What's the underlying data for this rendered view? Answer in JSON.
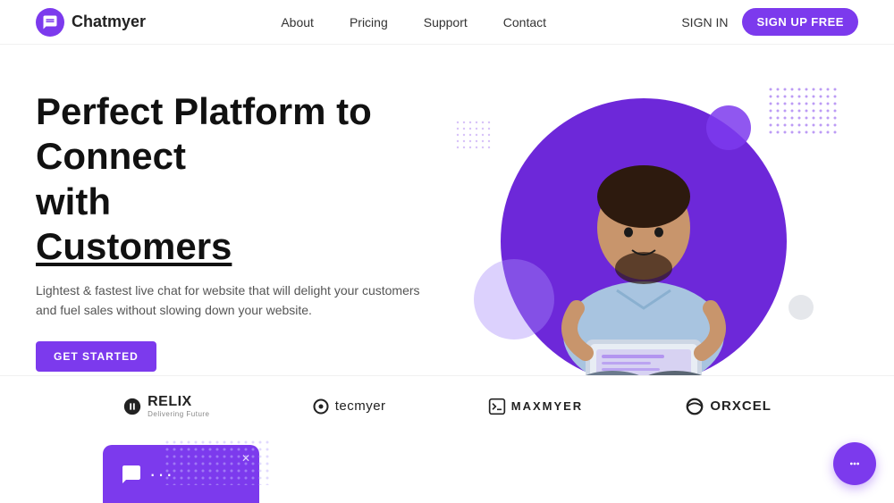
{
  "brand": {
    "icon": "💬",
    "name": "Chatmyer"
  },
  "navbar": {
    "links": [
      {
        "label": "About",
        "id": "about"
      },
      {
        "label": "Pricing",
        "id": "pricing"
      },
      {
        "label": "Support",
        "id": "support"
      },
      {
        "label": "Contact",
        "id": "contact"
      }
    ],
    "sign_in_label": "SIGN IN",
    "sign_up_label": "SIGN UP FREE"
  },
  "hero": {
    "title_line1": "Perfect Platform to Connect",
    "title_line2": "with",
    "title_underline": "Customers",
    "subtitle": "Lightest & fastest live chat for website that will delight your customers and fuel sales without slowing down your website.",
    "cta_label": "GET STARTED"
  },
  "logos": [
    {
      "id": "relix",
      "icon": "⚙",
      "name": "RELIX",
      "sub": "Delivering Future"
    },
    {
      "id": "tecmyer",
      "icon": "◎",
      "name": "tecmyer",
      "sub": ""
    },
    {
      "id": "maxmyer",
      "icon": "✕",
      "name": "MAXMYER",
      "sub": ""
    },
    {
      "id": "orxcel",
      "icon": "◑",
      "name": "ORXCEL",
      "sub": ""
    }
  ],
  "chat_widget": {
    "icon": "···"
  }
}
